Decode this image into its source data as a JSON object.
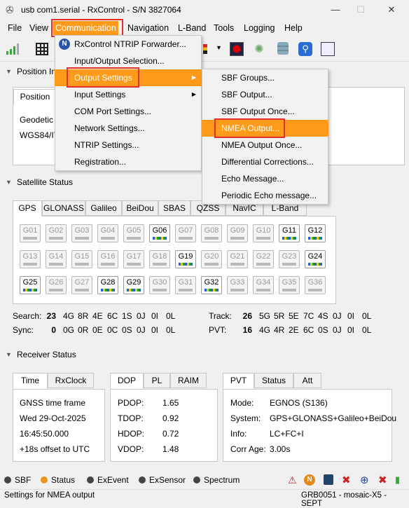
{
  "window": {
    "title": "usb com1.serial - RxControl - S/N 3827064"
  },
  "menubar": [
    "File",
    "View",
    "Communication",
    "Navigation",
    "L-Band",
    "Tools",
    "Logging",
    "Help"
  ],
  "comm_menu": [
    "RxControl NTRIP Forwarder...",
    "Input/Output Selection...",
    "Output Settings",
    "Input Settings",
    "COM Port Settings...",
    "Network Settings...",
    "NTRIP Settings...",
    "Registration..."
  ],
  "output_submenu": [
    "SBF Groups...",
    "SBF Output...",
    "SBF Output Once...",
    "NMEA Output...",
    "NMEA Output Once...",
    "Differential Corrections...",
    "Echo Message...",
    "Periodic Echo message..."
  ],
  "position": {
    "header": "Position In",
    "tab": "Position",
    "line1": "Geodetic",
    "line2": "WGS84/IT"
  },
  "satellite": {
    "header": "Satellite Status",
    "tabs": [
      "GPS",
      "GLONASS",
      "Galileo",
      "BeiDou",
      "SBAS",
      "QZSS",
      "NavIC",
      "L-Band"
    ],
    "rows": [
      [
        "G01",
        "G02",
        "G03",
        "G04",
        "G05",
        "G06",
        "G07",
        "G08",
        "G09",
        "G10",
        "G11",
        "G12"
      ],
      [
        "G13",
        "G14",
        "G15",
        "G16",
        "G17",
        "G18",
        "G19",
        "G20",
        "G21",
        "G22",
        "G23",
        "G24"
      ],
      [
        "G25",
        "G26",
        "G27",
        "G28",
        "G29",
        "G30",
        "G31",
        "G32",
        "G33",
        "G34",
        "G35",
        "G36"
      ]
    ],
    "active": [
      "G06",
      "G11",
      "G12",
      "G19",
      "G24",
      "G25",
      "G28",
      "G29",
      "G32"
    ],
    "search": {
      "label": "Search:",
      "total": "23",
      "vals": [
        "4G",
        "8R",
        "4E",
        "6C",
        "1S",
        "0J",
        "0I",
        "0L"
      ]
    },
    "sync": {
      "label": "Sync:",
      "total": "0",
      "vals": [
        "0G",
        "0R",
        "0E",
        "0C",
        "0S",
        "0J",
        "0I",
        "0L"
      ]
    },
    "track": {
      "label": "Track:",
      "total": "26",
      "vals": [
        "5G",
        "5R",
        "5E",
        "7C",
        "4S",
        "0J",
        "0I",
        "0L"
      ]
    },
    "pvt": {
      "label": "PVT:",
      "total": "16",
      "vals": [
        "4G",
        "4R",
        "2E",
        "6C",
        "0S",
        "0J",
        "0I",
        "0L"
      ]
    }
  },
  "receiver": {
    "header": "Receiver Status",
    "time_tabs": [
      "Time",
      "RxClock"
    ],
    "time": [
      "GNSS time frame",
      "Wed 29-Oct-2025",
      "16:45:50.000",
      "+18s offset to UTC"
    ],
    "dop_tabs": [
      "DOP",
      "PL",
      "RAIM"
    ],
    "dop": [
      [
        "PDOP:",
        "1.65"
      ],
      [
        "TDOP:",
        "0.92"
      ],
      [
        "HDOP:",
        "0.72"
      ],
      [
        "VDOP:",
        "1.48"
      ]
    ],
    "pvt_tabs": [
      "PVT",
      "Status",
      "Att"
    ],
    "pvt": [
      [
        "Mode:",
        "EGNOS (S136)"
      ],
      [
        "System:",
        "GPS+GLONASS+Galileo+BeiDou"
      ],
      [
        "Info:",
        "LC+FC+I"
      ],
      [
        "Corr Age:",
        "3.00s"
      ]
    ]
  },
  "indicators": [
    "SBF",
    "Status",
    "ExEvent",
    "ExSensor",
    "Spectrum"
  ],
  "statusbar": {
    "left": "Settings for NMEA output",
    "right": "GRB0051 - mosaic-X5 - SEPT"
  }
}
